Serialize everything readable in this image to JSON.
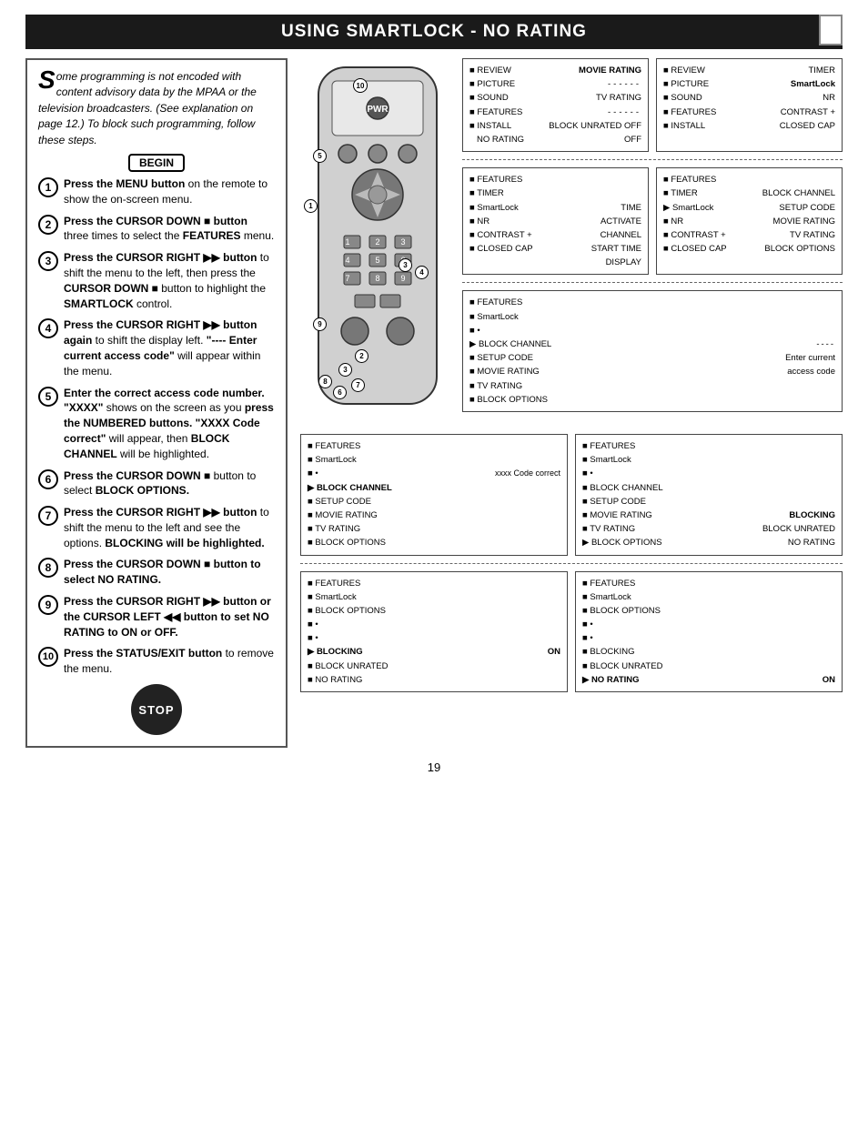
{
  "header": {
    "title": "Using SmartLock - No Rating",
    "title_display": "USING SMARTLOCK - NO RATING"
  },
  "intro": {
    "text": "ome programming is not encoded with content advisory data by the MPAA or the television broadcasters. (See explanation on page 12.) To block such programming, follow these steps."
  },
  "begin_label": "BEGIN",
  "stop_label": "STOP",
  "steps": [
    {
      "num": "1",
      "text": "Press the MENU button on the remote to show the on-screen menu."
    },
    {
      "num": "2",
      "text": "Press the CURSOR DOWN ■ button three times to select the FEATURES menu."
    },
    {
      "num": "3",
      "text": "Press the CURSOR RIGHT ▶▶ button to shift the menu to the left, then press the CURSOR DOWN ■ button to highlight the SMARTLOCK control."
    },
    {
      "num": "4",
      "text": "Press the CURSOR RIGHT ▶▶ button again to shift the display left. \"---- Enter current access code\" will appear within the menu."
    },
    {
      "num": "5",
      "text": "Enter the correct access code number. \"XXXX\" shows on the screen as you press the NUMBERED buttons. \"XXXX Code correct\" will appear, then BLOCK CHANNEL will be highlighted."
    },
    {
      "num": "6",
      "text": "Press the CURSOR DOWN ■ button to select BLOCK OPTIONS."
    },
    {
      "num": "7",
      "text": "Press the CURSOR RIGHT ▶▶ button to shift the menu to the left and see the options. BLOCKING will be highlighted."
    },
    {
      "num": "8",
      "text": "Press the CURSOR DOWN ■ button to select NO RATING."
    },
    {
      "num": "9",
      "text": "Press the CURSOR RIGHT ▶▶ button or the CURSOR LEFT ◀◀ button to set NO RATING to ON or OFF."
    },
    {
      "num": "10",
      "text": "Press the STATUS/EXIT button to remove the menu."
    }
  ],
  "page_number": "19",
  "menu_box1": {
    "items": [
      {
        "bullet": "■",
        "label": "REVIEW",
        "right": "MOVIE RATING"
      },
      {
        "bullet": "■",
        "label": "PICTURE",
        "right": "------"
      },
      {
        "bullet": "■",
        "label": "SOUND",
        "right": "TV RATING"
      },
      {
        "bullet": "■",
        "label": "FEATURES",
        "right": "------"
      },
      {
        "bullet": "■",
        "label": "INSTALL",
        "right": "BLOCK UNRATED OFF"
      },
      {
        "bullet": "",
        "label": "NO RATING",
        "right": "OFF"
      }
    ]
  },
  "menu_box2": {
    "items": [
      {
        "bullet": "■",
        "label": "REVIEW",
        "right": "TIMER"
      },
      {
        "bullet": "■",
        "label": "PICTURE",
        "right": "SmartLock"
      },
      {
        "bullet": "■",
        "label": "SOUND",
        "right": "NR"
      },
      {
        "bullet": "■",
        "label": "FEATURES",
        "right": "CONTRAST +"
      },
      {
        "bullet": "■",
        "label": "INSTALL",
        "right": "CLOSED CAP"
      }
    ]
  },
  "menu_box3": {
    "items": [
      {
        "bullet": "■",
        "label": "FEATURES",
        "right": ""
      },
      {
        "bullet": "■",
        "label": "TIMER",
        "right": ""
      },
      {
        "bullet": "■",
        "label": "SmartLock",
        "right": "TIME"
      },
      {
        "bullet": "■",
        "label": "NR",
        "right": "ACTIVATE"
      },
      {
        "bullet": "■",
        "label": "CONTRAST +",
        "right": "CHANNEL"
      },
      {
        "bullet": "■",
        "label": "CLOSED CAP",
        "right": "START TIME"
      },
      {
        "bullet": "",
        "label": "",
        "right": "DISPLAY"
      }
    ]
  },
  "menu_box4": {
    "items": [
      {
        "bullet": "■",
        "label": "FEATURES",
        "right": ""
      },
      {
        "bullet": "■",
        "label": "TIMER",
        "right": "BLOCK CHANNEL"
      },
      {
        "bullet": "▶",
        "label": "SmartLock",
        "right": "SETUP CODE"
      },
      {
        "bullet": "■",
        "label": "NR",
        "right": "MOVIE RATING"
      },
      {
        "bullet": "■",
        "label": "CONTRAST +",
        "right": "TV RATING"
      },
      {
        "bullet": "■",
        "label": "CLOSED CAP",
        "right": "BLOCK OPTIONS"
      }
    ]
  },
  "menu_box5": {
    "items": [
      {
        "bullet": "■",
        "label": "FEATURES",
        "right": ""
      },
      {
        "bullet": "■",
        "label": "SmartLock",
        "right": ""
      },
      {
        "bullet": "■",
        "label": "•",
        "right": ""
      },
      {
        "bullet": "■",
        "label": "BLOCK CHANNEL",
        "right": "----"
      },
      {
        "bullet": "■",
        "label": "SETUP CODE",
        "right": "Enter current"
      },
      {
        "bullet": "■",
        "label": "MOVIE RATING",
        "right": "access code"
      },
      {
        "bullet": "■",
        "label": "TV RATING",
        "right": ""
      },
      {
        "bullet": "■",
        "label": "BLOCK OPTIONS",
        "right": ""
      }
    ]
  },
  "menu_box6": {
    "items": [
      {
        "bullet": "■",
        "label": "FEATURES",
        "right": ""
      },
      {
        "bullet": "■",
        "label": "SmartLock",
        "right": ""
      },
      {
        "bullet": "■",
        "label": "•",
        "right": "xxxx Code correct"
      },
      {
        "bullet": "▶",
        "label": "BLOCK CHANNEL",
        "right": ""
      },
      {
        "bullet": "■",
        "label": "SETUP CODE",
        "right": ""
      },
      {
        "bullet": "■",
        "label": "MOVIE RATING",
        "right": ""
      },
      {
        "bullet": "■",
        "label": "TV RATING",
        "right": ""
      },
      {
        "bullet": "■",
        "label": "BLOCK OPTIONS",
        "right": ""
      }
    ]
  },
  "menu_box7": {
    "items": [
      {
        "bullet": "■",
        "label": "FEATURES",
        "right": ""
      },
      {
        "bullet": "■",
        "label": "SmartLock",
        "right": ""
      },
      {
        "bullet": "■",
        "label": "•",
        "right": ""
      },
      {
        "bullet": "■",
        "label": "BLOCK CHANNEL",
        "right": ""
      },
      {
        "bullet": "■",
        "label": "SETUP CODE",
        "right": ""
      },
      {
        "bullet": "■",
        "label": "MOVIE RATING",
        "right": "BLOCKING"
      },
      {
        "bullet": "■",
        "label": "TV RATING",
        "right": "BLOCK UNRATED"
      },
      {
        "bullet": "▶",
        "label": "BLOCK OPTIONS",
        "right": "NO RATING"
      }
    ]
  },
  "menu_box8": {
    "items": [
      {
        "bullet": "■",
        "label": "FEATURES",
        "right": ""
      },
      {
        "bullet": "■",
        "label": "SmartLock",
        "right": ""
      },
      {
        "bullet": "■",
        "label": "BLOCK OPTIONS",
        "right": ""
      },
      {
        "bullet": "■",
        "label": "•",
        "right": ""
      },
      {
        "bullet": "■",
        "label": "•",
        "right": ""
      },
      {
        "bullet": "▶",
        "label": "BLOCKING",
        "right": "ON"
      },
      {
        "bullet": "■",
        "label": "BLOCK UNRATED",
        "right": ""
      },
      {
        "bullet": "■",
        "label": "NO RATING",
        "right": ""
      }
    ]
  },
  "menu_box9": {
    "items": [
      {
        "bullet": "■",
        "label": "FEATURES",
        "right": ""
      },
      {
        "bullet": "■",
        "label": "SmartLock",
        "right": ""
      },
      {
        "bullet": "■",
        "label": "BLOCK OPTIONS",
        "right": ""
      },
      {
        "bullet": "■",
        "label": "•",
        "right": ""
      },
      {
        "bullet": "■",
        "label": "•",
        "right": ""
      },
      {
        "bullet": "■",
        "label": "BLOCKING",
        "right": ""
      },
      {
        "bullet": "■",
        "label": "BLOCK UNRATED",
        "right": ""
      },
      {
        "bullet": "▶",
        "label": "NO RATING",
        "right": "ON"
      }
    ]
  }
}
